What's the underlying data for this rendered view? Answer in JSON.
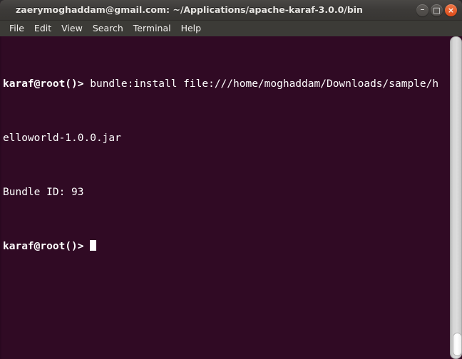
{
  "window": {
    "title": "zaerymoghaddam@gmail.com: ~/Applications/apache-karaf-3.0.0/bin",
    "bg_color": "#300a24",
    "titlebar_color": "#3d3b39",
    "close_color": "#dc4a19"
  },
  "window_buttons": [
    {
      "name": "minimize",
      "glyph": "–"
    },
    {
      "name": "maximize",
      "glyph": "□"
    },
    {
      "name": "close",
      "glyph": "×"
    }
  ],
  "menubar": {
    "items": [
      {
        "label": "File"
      },
      {
        "label": "Edit"
      },
      {
        "label": "View"
      },
      {
        "label": "Search"
      },
      {
        "label": "Terminal"
      },
      {
        "label": "Help"
      }
    ]
  },
  "terminal": {
    "prompt": "karaf@root()>",
    "lines": [
      {
        "prompt": "karaf@root()>",
        "text": " bundle:install file:///home/moghaddam/Downloads/sample/h"
      },
      {
        "prompt": "",
        "text": "elloworld-1.0.0.jar"
      },
      {
        "prompt": "",
        "text": "Bundle ID: 93"
      }
    ],
    "current_prompt": "karaf@root()>",
    "current_input": " ",
    "cursor": "block",
    "full_command": "bundle:install file:///home/moghaddam/Downloads/sample/helloworld-1.0.0.jar",
    "bundle_id": "93"
  },
  "scrollbar": {
    "orientation": "vertical",
    "thumb_position": "bottom"
  }
}
